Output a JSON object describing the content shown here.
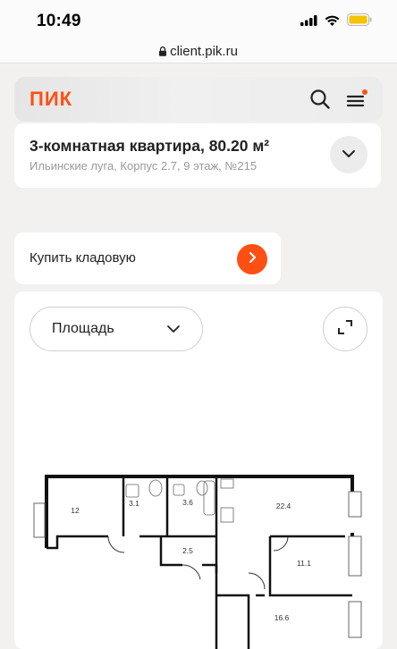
{
  "statusbar": {
    "time": "10:49",
    "icons": [
      "signal-icon",
      "wifi-icon",
      "battery-icon"
    ]
  },
  "browser": {
    "url": "client.pik.ru"
  },
  "header": {
    "logo": "ПИК",
    "icons": [
      "search-icon",
      "menu-icon"
    ],
    "notification_color": "#ff4f12"
  },
  "apartment": {
    "title": "3-комнатная квартира, 80.20 м²",
    "subtitle": "Ильинские луга, Корпус 2.7, 9 этаж, №215"
  },
  "storage": {
    "label": "Купить кладовую"
  },
  "plan": {
    "select_value": "Площадь",
    "rooms": [
      "12",
      "3.1",
      "3.6",
      "22.4",
      "2.5",
      "11.1",
      "16.6"
    ]
  },
  "colors": {
    "accent": "#ff4f12",
    "background": "#f2f1ef"
  }
}
